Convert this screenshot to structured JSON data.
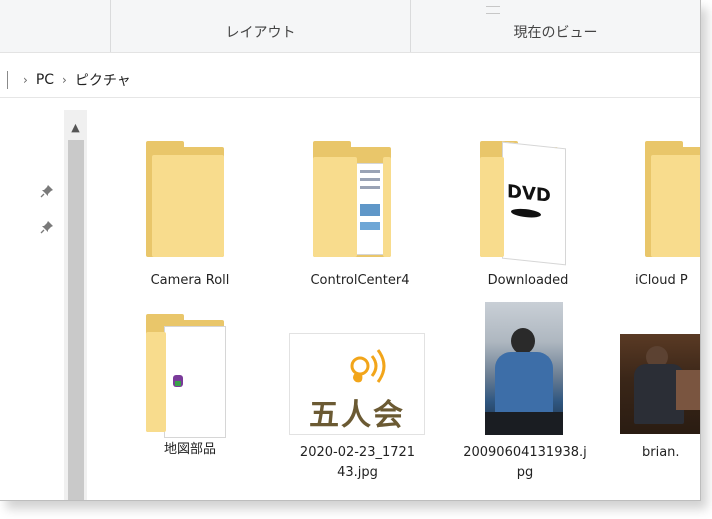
{
  "ribbon": {
    "groups": [
      "",
      "レイアウト",
      "現在のビュー"
    ]
  },
  "address": {
    "crumbs": [
      "PC",
      "ピクチャ"
    ]
  },
  "items": [
    {
      "label": "Camera Roll",
      "type": "folder"
    },
    {
      "label": "ControlCenter4",
      "type": "folder-docs"
    },
    {
      "label": "Downloaded",
      "type": "folder-dvd"
    },
    {
      "label": "iCloud P",
      "type": "folder"
    },
    {
      "label": "地図部品",
      "type": "folder-paper"
    },
    {
      "label_line1": "2020-02-23_1721",
      "label_line2": "43.jpg",
      "type": "image-logo"
    },
    {
      "label_line1": "20090604131938.j",
      "label_line2": "pg",
      "type": "image-photo"
    },
    {
      "label": "brian.",
      "type": "image-photo2"
    }
  ],
  "logo_text": "五人会",
  "dvd_text": "DVD",
  "colors": {
    "folder_back": "#e9c66a",
    "folder_front": "#f8dc8d",
    "logo_gold": "#f2a51a",
    "logo_text": "#6b5a33"
  }
}
